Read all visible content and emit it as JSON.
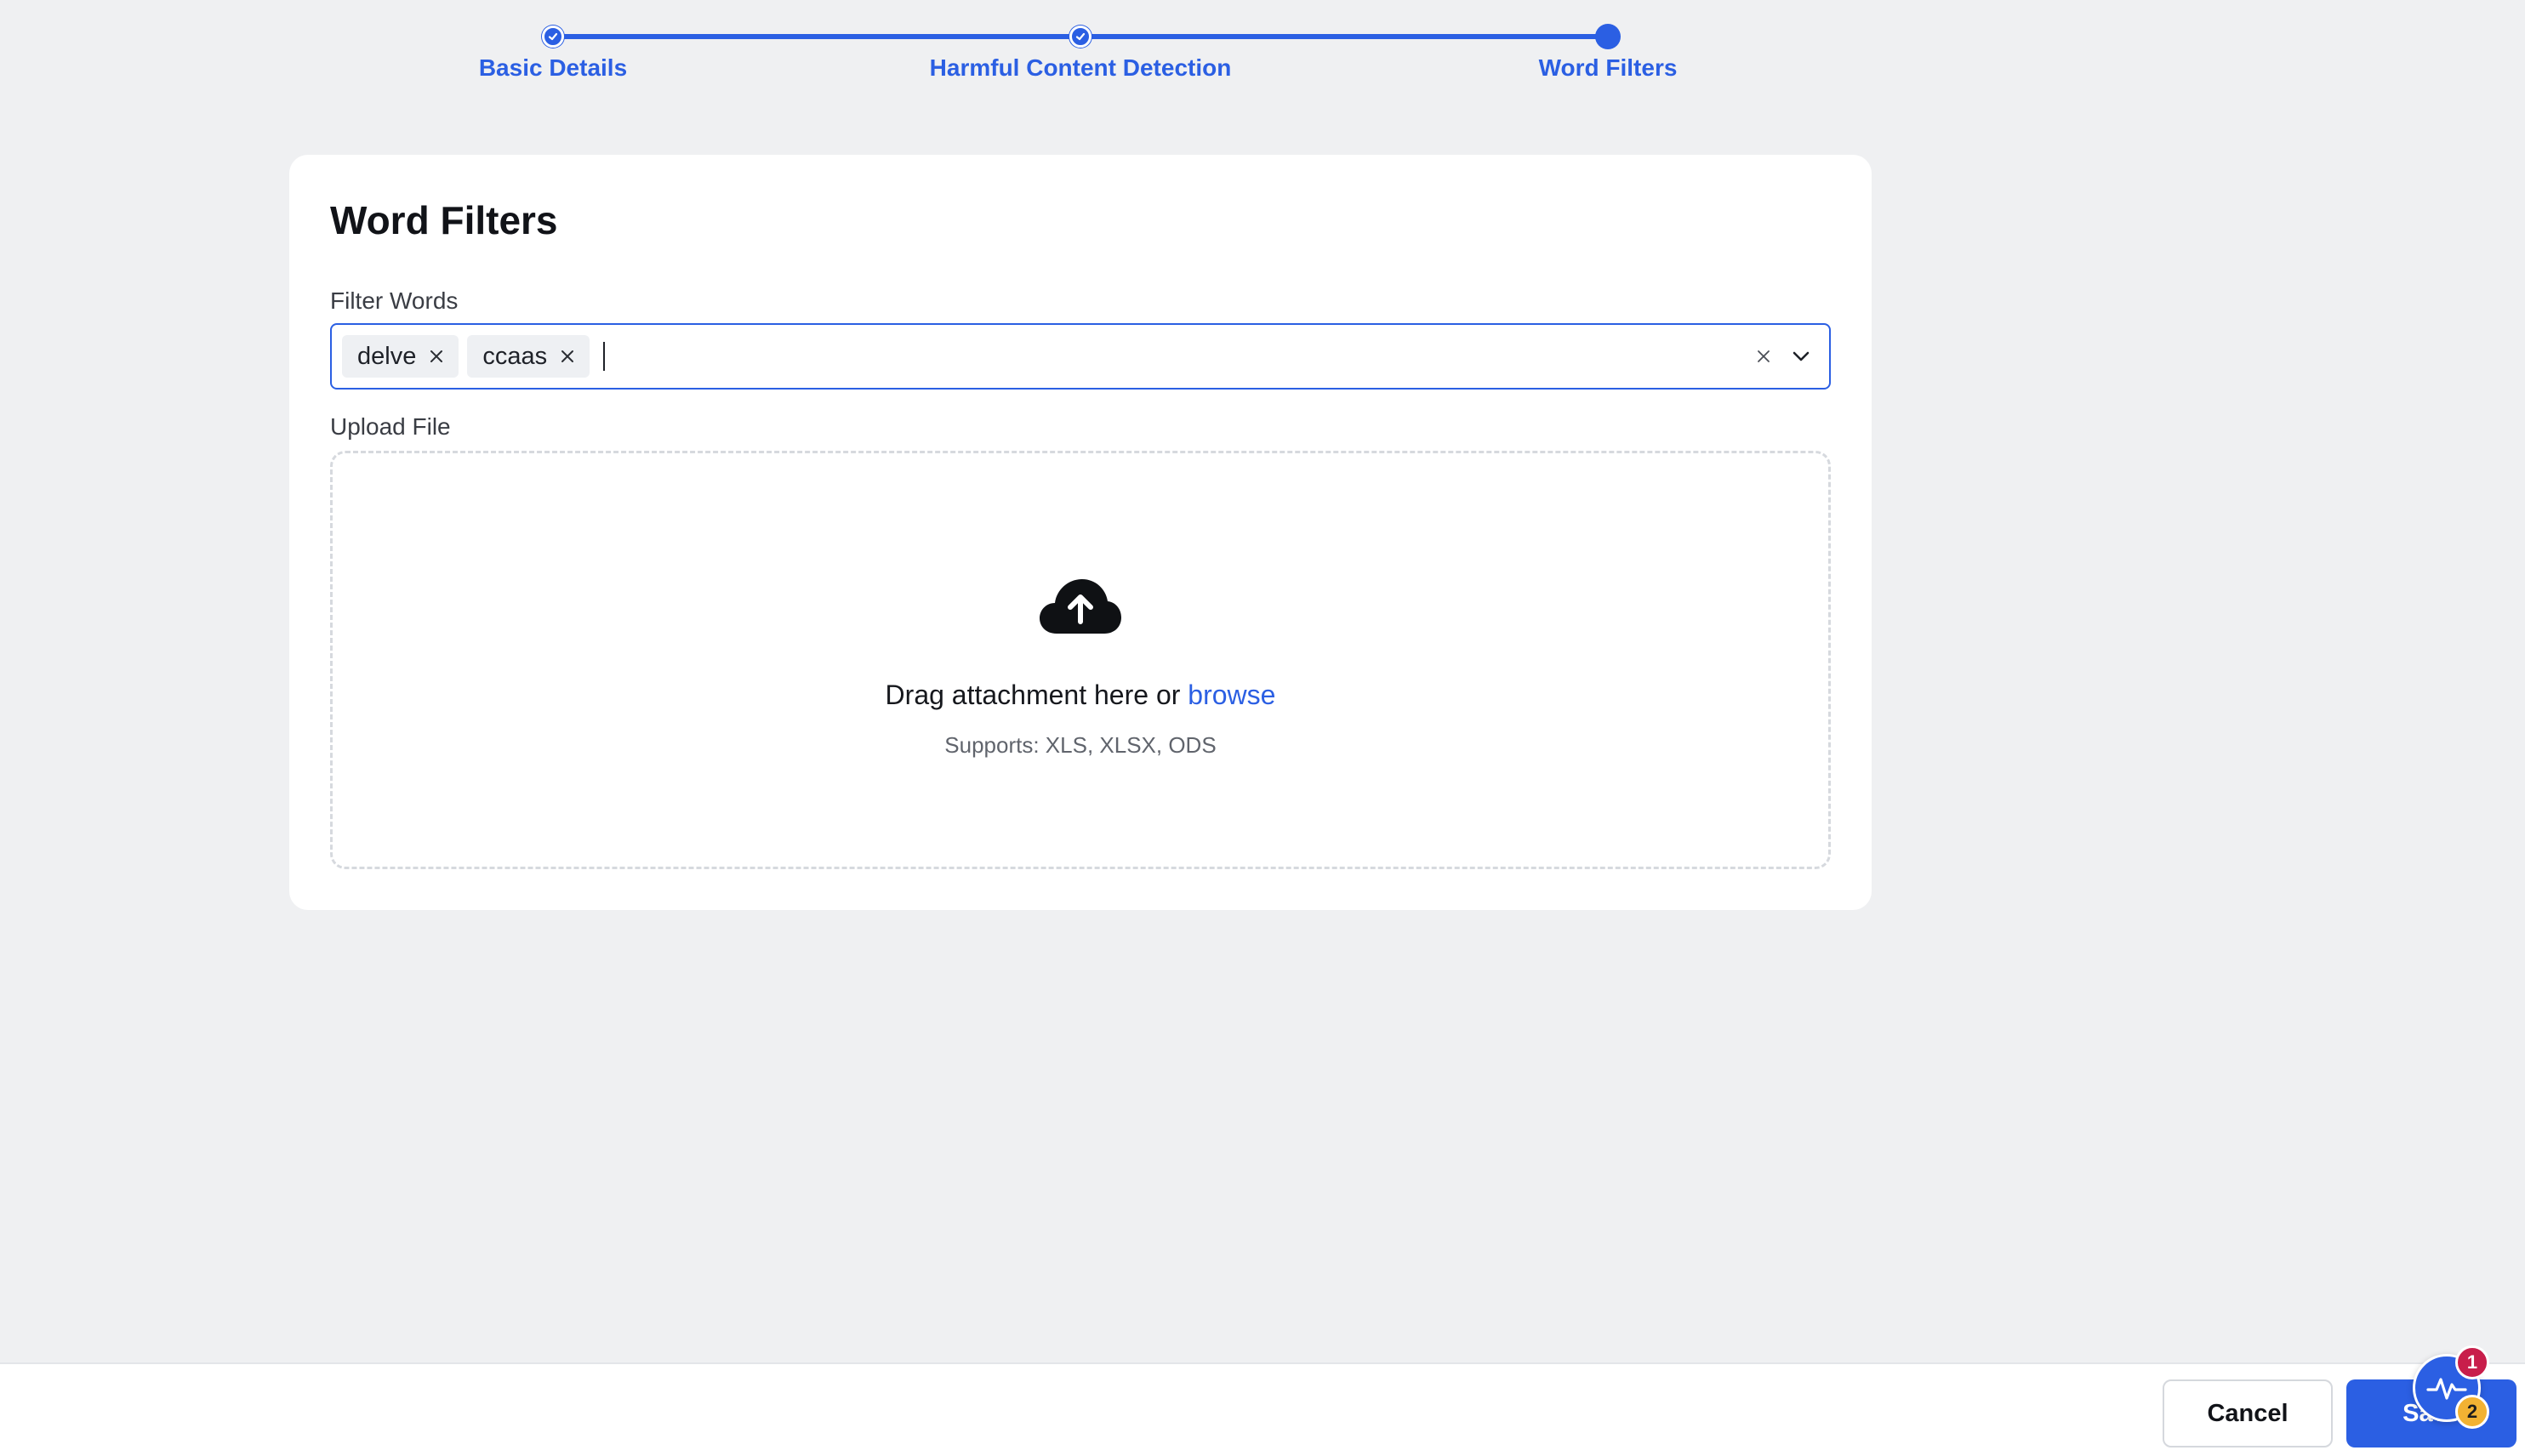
{
  "stepper": {
    "steps": [
      {
        "label": "Basic Details",
        "status": "completed"
      },
      {
        "label": "Harmful Content Detection",
        "status": "completed"
      },
      {
        "label": "Word Filters",
        "status": "current"
      }
    ]
  },
  "card": {
    "title": "Word Filters",
    "filter_words": {
      "label": "Filter Words",
      "tags": [
        "delve",
        "ccaas"
      ]
    },
    "upload": {
      "label": "Upload File",
      "drag_text": "Drag attachment here or",
      "browse_label": "browse",
      "supports_text": "Supports: XLS, XLSX, ODS",
      "icon": "cloud-upload-icon"
    }
  },
  "footer": {
    "cancel_label": "Cancel",
    "save_label": "Save"
  },
  "widget": {
    "icon": "activity-pulse-icon",
    "badge_red": "1",
    "badge_yellow": "2"
  },
  "colors": {
    "accent": "#2b5fe3",
    "background": "#eff0f2",
    "badge_red": "#c81e4b",
    "badge_yellow": "#f2b233"
  }
}
